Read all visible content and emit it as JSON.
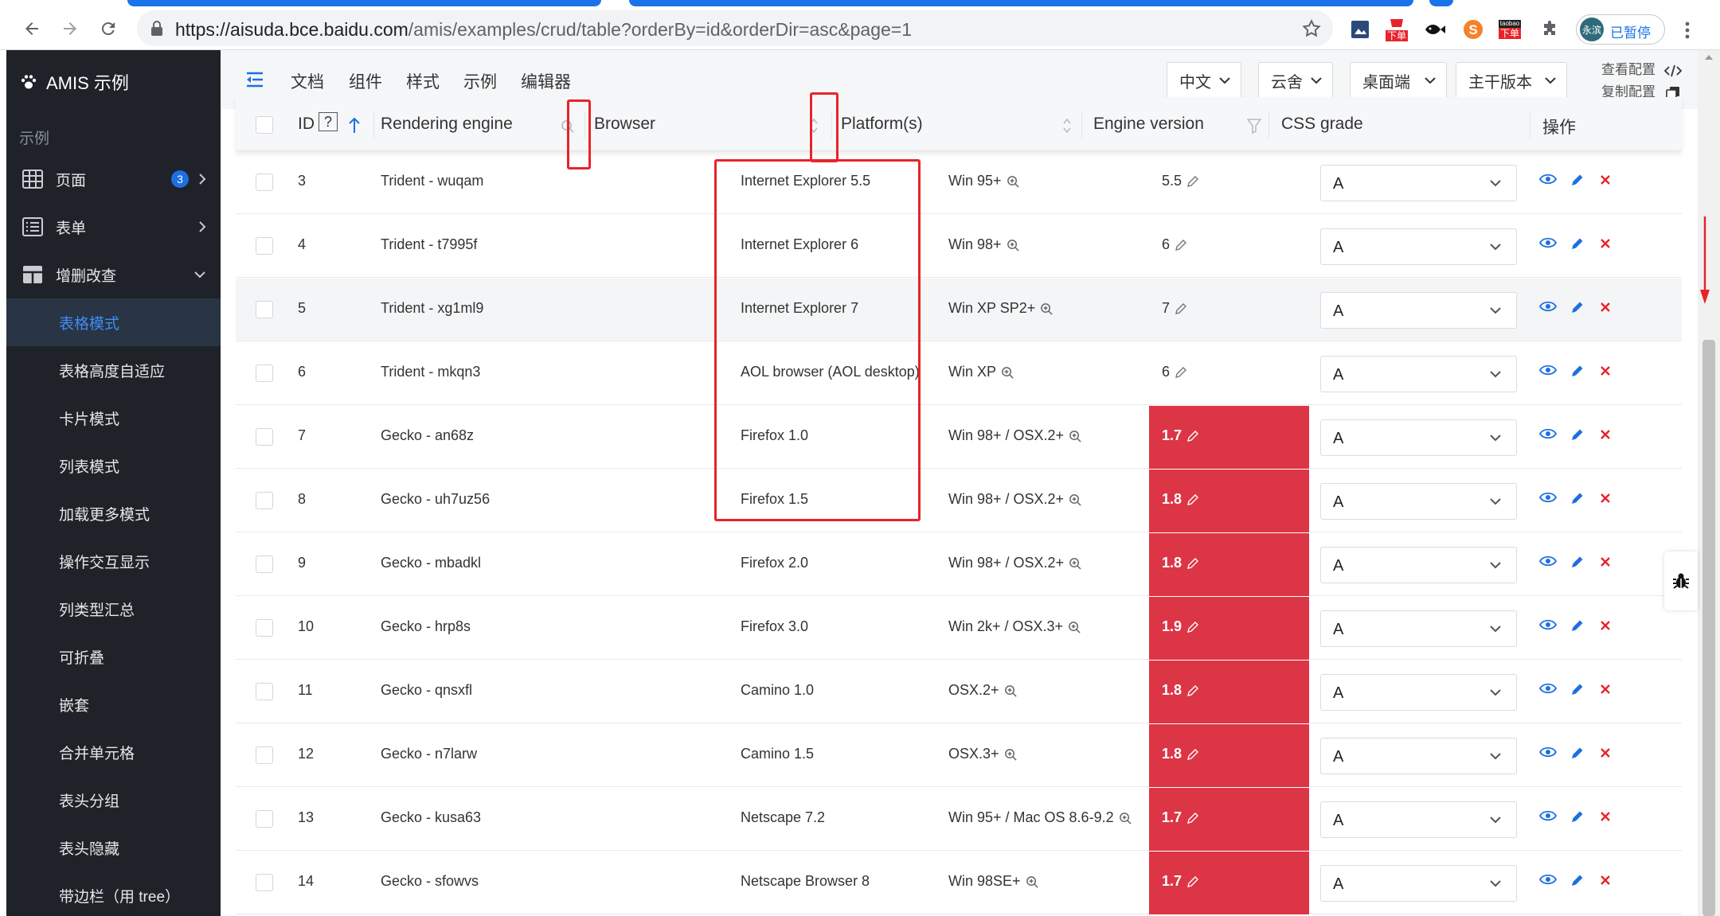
{
  "browser": {
    "url_host": "https://aisuda.bce.baidu.com",
    "url_path": "/amis/examples/crud/table?orderBy=id&orderDir=asc&page=1",
    "profile_avatar": "永滨",
    "profile_label": "已暂停",
    "ext_badge_1": "下单",
    "ext_badge_2": "下单",
    "ext_badge_2_top": "taobao",
    "colors": {
      "tab_blue": "#1a73e8",
      "badge_red": "#e8232a"
    }
  },
  "sidebar": {
    "brand": "AMIS 示例",
    "section": "示例",
    "items": [
      {
        "label": "页面",
        "badge": "3"
      },
      {
        "label": "表单"
      },
      {
        "label": "增删改查"
      }
    ],
    "subitems": [
      {
        "label": "表格模式",
        "active": true
      },
      {
        "label": "表格高度自适应"
      },
      {
        "label": "卡片模式"
      },
      {
        "label": "列表模式"
      },
      {
        "label": "加载更多模式"
      },
      {
        "label": "操作交互显示"
      },
      {
        "label": "列类型汇总"
      },
      {
        "label": "可折叠"
      },
      {
        "label": "嵌套"
      },
      {
        "label": "合并单元格"
      },
      {
        "label": "表头分组"
      },
      {
        "label": "表头隐藏"
      },
      {
        "label": "带边栏（用 tree）"
      }
    ]
  },
  "header": {
    "nav": [
      "文档",
      "组件",
      "样式",
      "示例",
      "编辑器"
    ],
    "selects": [
      "中文",
      "云舍",
      "桌面端",
      "主干版本"
    ],
    "view_config": "查看配置",
    "copy_config": "复制配置"
  },
  "table": {
    "columns": [
      "ID",
      "Rendering engine",
      "Browser",
      "Platform(s)",
      "Engine version",
      "CSS grade",
      "操作"
    ],
    "id_help": "?",
    "rows": [
      {
        "id": "3",
        "engine": "Trident - wuqam",
        "browser": "Internet Explorer 5.5",
        "platform": "Win 95+",
        "version": "5.5",
        "grade": "A",
        "highlight": false
      },
      {
        "id": "4",
        "engine": "Trident - t7995f",
        "browser": "Internet Explorer 6",
        "platform": "Win 98+",
        "version": "6",
        "grade": "A",
        "highlight": false
      },
      {
        "id": "5",
        "engine": "Trident - xg1ml9",
        "browser": "Internet Explorer 7",
        "platform": "Win XP SP2+",
        "version": "7",
        "grade": "A",
        "highlight": false
      },
      {
        "id": "6",
        "engine": "Trident - mkqn3",
        "browser": "AOL browser (AOL desktop)",
        "platform": "Win XP",
        "version": "6",
        "grade": "A",
        "highlight": false
      },
      {
        "id": "7",
        "engine": "Gecko - an68z",
        "browser": "Firefox 1.0",
        "platform": "Win 98+ / OSX.2+",
        "version": "1.7",
        "grade": "A",
        "highlight": true
      },
      {
        "id": "8",
        "engine": "Gecko - uh7uz56",
        "browser": "Firefox 1.5",
        "platform": "Win 98+ / OSX.2+",
        "version": "1.8",
        "grade": "A",
        "highlight": true
      },
      {
        "id": "9",
        "engine": "Gecko - mbadkl",
        "browser": "Firefox 2.0",
        "platform": "Win 98+ / OSX.2+",
        "version": "1.8",
        "grade": "A",
        "highlight": true
      },
      {
        "id": "10",
        "engine": "Gecko - hrp8s",
        "browser": "Firefox 3.0",
        "platform": "Win 2k+ / OSX.3+",
        "version": "1.9",
        "grade": "A",
        "highlight": true
      },
      {
        "id": "11",
        "engine": "Gecko - qnsxfl",
        "browser": "Camino 1.0",
        "platform": "OSX.2+",
        "version": "1.8",
        "grade": "A",
        "highlight": true
      },
      {
        "id": "12",
        "engine": "Gecko - n7larw",
        "browser": "Camino 1.5",
        "platform": "OSX.3+",
        "version": "1.8",
        "grade": "A",
        "highlight": true
      },
      {
        "id": "13",
        "engine": "Gecko - kusa63",
        "browser": "Netscape 7.2",
        "platform": "Win 95+ / Mac OS 8.6-9.2",
        "version": "1.7",
        "grade": "A",
        "highlight": true
      },
      {
        "id": "14",
        "engine": "Gecko - sfowvs",
        "browser": "Netscape Browser 8",
        "platform": "Win 98SE+",
        "version": "1.7",
        "grade": "A",
        "highlight": true
      }
    ]
  }
}
